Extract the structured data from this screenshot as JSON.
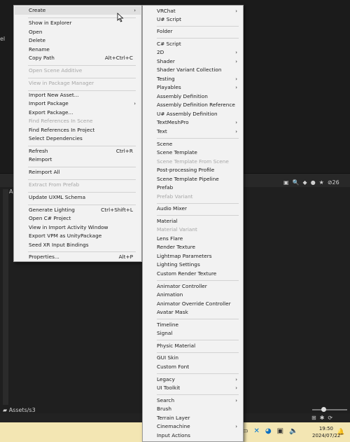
{
  "background": {
    "left_label": "el",
    "panel_letter": "A",
    "asset_path": "Assets/s3",
    "badge_count": "26"
  },
  "taskbar": {
    "time": "19:50",
    "date": "2024/07/22"
  },
  "context_menu": {
    "items": [
      {
        "label": "Create",
        "type": "submenu",
        "highlighted": true
      },
      {
        "label": "Show in Explorer"
      },
      {
        "label": "Open"
      },
      {
        "label": "Delete"
      },
      {
        "label": "Rename"
      },
      {
        "label": "Copy Path",
        "shortcut": "Alt+Ctrl+C"
      },
      {
        "label": "Open Scene Additive",
        "disabled": true
      },
      {
        "label": "View in Package Manager",
        "disabled": true
      },
      {
        "label": "Import New Asset..."
      },
      {
        "label": "Import Package",
        "type": "submenu"
      },
      {
        "label": "Export Package..."
      },
      {
        "label": "Find References In Scene",
        "disabled": true
      },
      {
        "label": "Find References In Project"
      },
      {
        "label": "Select Dependencies"
      },
      {
        "label": "Refresh",
        "shortcut": "Ctrl+R"
      },
      {
        "label": "Reimport"
      },
      {
        "label": "Reimport All"
      },
      {
        "label": "Extract From Prefab",
        "disabled": true
      },
      {
        "label": "Update UXML Schema"
      },
      {
        "label": "Generate Lighting",
        "shortcut": "Ctrl+Shift+L"
      },
      {
        "label": "Open C# Project"
      },
      {
        "label": "View in Import Activity Window"
      },
      {
        "label": "Export VPM as UnityPackage"
      },
      {
        "label": "Seed XR Input Bindings"
      },
      {
        "label": "Properties...",
        "shortcut": "Alt+P"
      }
    ]
  },
  "create_submenu": {
    "items": [
      {
        "label": "VRChat",
        "type": "submenu"
      },
      {
        "label": "U# Script"
      },
      {
        "label": "Folder"
      },
      {
        "label": "C# Script"
      },
      {
        "label": "2D",
        "type": "submenu"
      },
      {
        "label": "Shader",
        "type": "submenu"
      },
      {
        "label": "Shader Variant Collection"
      },
      {
        "label": "Testing",
        "type": "submenu"
      },
      {
        "label": "Playables",
        "type": "submenu"
      },
      {
        "label": "Assembly Definition"
      },
      {
        "label": "Assembly Definition Reference"
      },
      {
        "label": "U# Assembly Definition"
      },
      {
        "label": "TextMeshPro",
        "type": "submenu"
      },
      {
        "label": "Text",
        "type": "submenu"
      },
      {
        "label": "Scene"
      },
      {
        "label": "Scene Template"
      },
      {
        "label": "Scene Template From Scene",
        "disabled": true
      },
      {
        "label": "Post-processing Profile"
      },
      {
        "label": "Scene Template Pipeline"
      },
      {
        "label": "Prefab"
      },
      {
        "label": "Prefab Variant",
        "disabled": true
      },
      {
        "label": "Audio Mixer"
      },
      {
        "label": "Material"
      },
      {
        "label": "Material Variant",
        "disabled": true
      },
      {
        "label": "Lens Flare"
      },
      {
        "label": "Render Texture"
      },
      {
        "label": "Lightmap Parameters"
      },
      {
        "label": "Lighting Settings"
      },
      {
        "label": "Custom Render Texture"
      },
      {
        "label": "Animator Controller"
      },
      {
        "label": "Animation"
      },
      {
        "label": "Animator Override Controller"
      },
      {
        "label": "Avatar Mask"
      },
      {
        "label": "Timeline"
      },
      {
        "label": "Signal"
      },
      {
        "label": "Physic Material"
      },
      {
        "label": "GUI Skin"
      },
      {
        "label": "Custom Font"
      },
      {
        "label": "Legacy",
        "type": "submenu"
      },
      {
        "label": "UI Toolkit",
        "type": "submenu"
      },
      {
        "label": "Search",
        "type": "submenu"
      },
      {
        "label": "Brush"
      },
      {
        "label": "Terrain Layer"
      },
      {
        "label": "Cinemachine",
        "type": "submenu"
      },
      {
        "label": "Input Actions"
      }
    ]
  },
  "icons": {
    "submenu_arrow": "chevron-right-icon",
    "cursor": "mouse-pointer-icon"
  }
}
